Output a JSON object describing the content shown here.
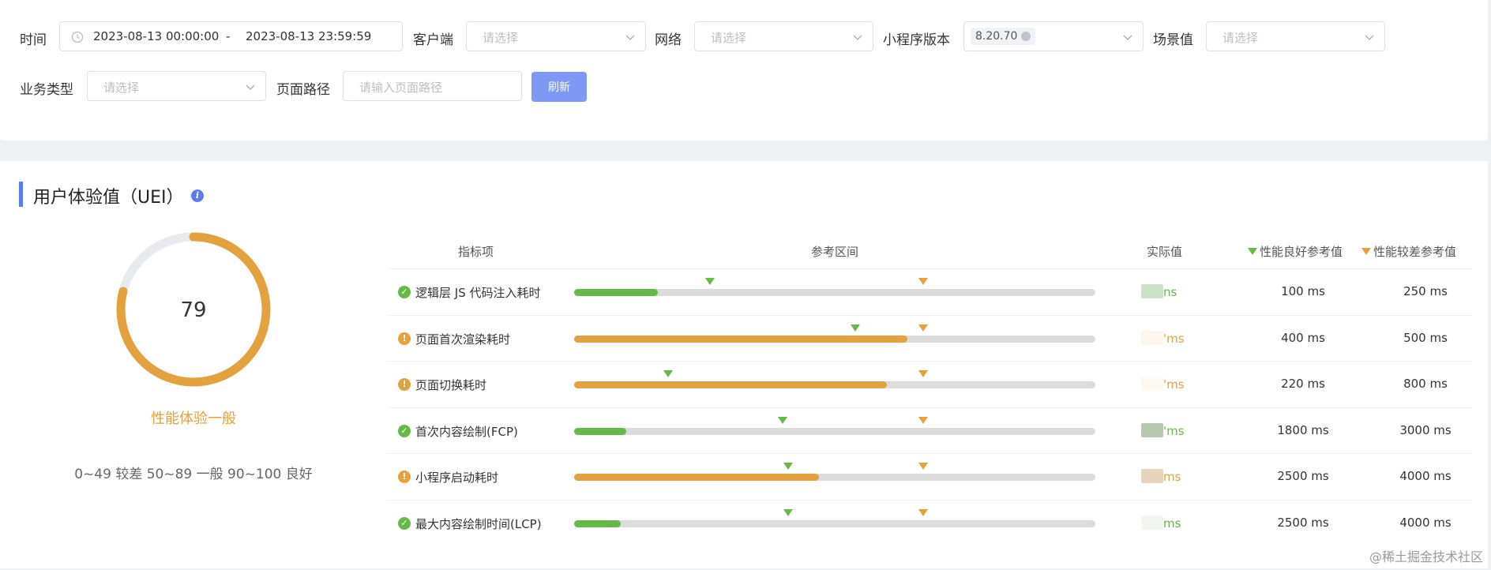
{
  "filters": {
    "time_label": "时间",
    "start_time": "2023-08-13 00:00:00",
    "range_sep": "-",
    "end_time": "2023-08-13 23:59:59",
    "client_label": "客户端",
    "client_placeholder": "请选择",
    "network_label": "网络",
    "network_placeholder": "请选择",
    "version_label": "小程序版本",
    "version_tag": "8.20.70",
    "scene_label": "场景值",
    "scene_placeholder": "请选择",
    "biz_label": "业务类型",
    "biz_placeholder": "请选择",
    "path_label": "页面路径",
    "path_placeholder": "请输入页面路径",
    "refresh_label": "刷新"
  },
  "uei": {
    "title": "用户体验值（UEI）",
    "info_icon": "i",
    "score": 79,
    "score_max": 100,
    "grade": "性能体验一般",
    "legend": "0~49 较差 50~89 一般 90~100 良好",
    "colors": {
      "accent": "#e2a23f",
      "track": "#e8eaf0",
      "brand": "#5b7cf0",
      "good": "#67b74a"
    }
  },
  "table": {
    "headers": {
      "metric": "指标项",
      "range": "参考区间",
      "actual": "实际值",
      "good": "性能良好参考值",
      "bad": "性能较差参考值"
    },
    "rows": [
      {
        "status": "good",
        "icon": "✓",
        "name": "逻辑层 JS 代码注入耗时",
        "fill": 0.16,
        "good_mark": 0.26,
        "bad_mark": 0.67,
        "actual_unit": "ns",
        "good_ref": "100 ms",
        "bad_ref": "250 ms",
        "blur_color": "#cde3c7"
      },
      {
        "status": "warn",
        "icon": "!",
        "name": "页面首次渲染耗时",
        "fill": 0.64,
        "good_mark": 0.54,
        "bad_mark": 0.67,
        "actual_unit": "'ms",
        "good_ref": "400 ms",
        "bad_ref": "500 ms",
        "blur_color": "#fdf7ee"
      },
      {
        "status": "warn",
        "icon": "!",
        "name": "页面切换耗时",
        "fill": 0.6,
        "good_mark": 0.18,
        "bad_mark": 0.67,
        "actual_unit": "'ms",
        "good_ref": "220 ms",
        "bad_ref": "800 ms",
        "blur_color": "#fdf9f1"
      },
      {
        "status": "good",
        "icon": "✓",
        "name": "首次内容绘制(FCP)",
        "fill": 0.1,
        "good_mark": 0.4,
        "bad_mark": 0.67,
        "actual_unit": "'ms",
        "good_ref": "1800 ms",
        "bad_ref": "3000 ms",
        "blur_color": "#b7c8ae"
      },
      {
        "status": "warn",
        "icon": "!",
        "name": "小程序启动耗时",
        "fill": 0.47,
        "good_mark": 0.41,
        "bad_mark": 0.67,
        "actual_unit": "ms",
        "good_ref": "2500 ms",
        "bad_ref": "4000 ms",
        "blur_color": "#e8d4bd"
      },
      {
        "status": "good",
        "icon": "✓",
        "name": "最大内容绘制时间(LCP)",
        "fill": 0.09,
        "good_mark": 0.41,
        "bad_mark": 0.67,
        "actual_unit": "ms",
        "good_ref": "2500 ms",
        "bad_ref": "4000 ms",
        "blur_color": "#f1f7ef"
      }
    ]
  },
  "watermark": "@稀土掘金技术社区"
}
